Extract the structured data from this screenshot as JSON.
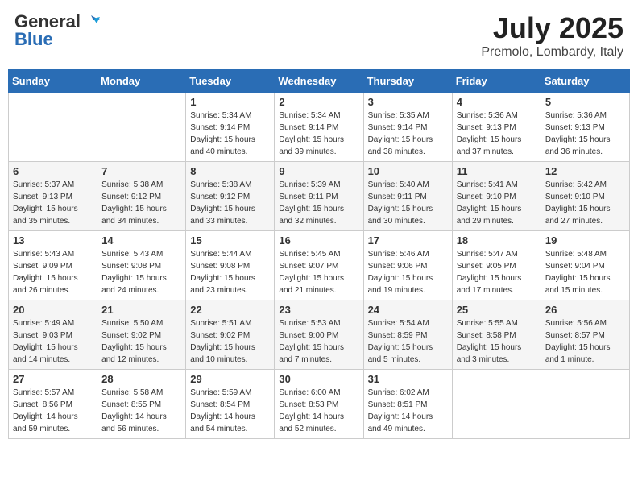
{
  "header": {
    "logo_line1": "General",
    "logo_line2": "Blue",
    "month": "July 2025",
    "location": "Premolo, Lombardy, Italy"
  },
  "weekdays": [
    "Sunday",
    "Monday",
    "Tuesday",
    "Wednesday",
    "Thursday",
    "Friday",
    "Saturday"
  ],
  "weeks": [
    [
      {
        "day": "",
        "info": ""
      },
      {
        "day": "",
        "info": ""
      },
      {
        "day": "1",
        "info": "Sunrise: 5:34 AM\nSunset: 9:14 PM\nDaylight: 15 hours\nand 40 minutes."
      },
      {
        "day": "2",
        "info": "Sunrise: 5:34 AM\nSunset: 9:14 PM\nDaylight: 15 hours\nand 39 minutes."
      },
      {
        "day": "3",
        "info": "Sunrise: 5:35 AM\nSunset: 9:14 PM\nDaylight: 15 hours\nand 38 minutes."
      },
      {
        "day": "4",
        "info": "Sunrise: 5:36 AM\nSunset: 9:13 PM\nDaylight: 15 hours\nand 37 minutes."
      },
      {
        "day": "5",
        "info": "Sunrise: 5:36 AM\nSunset: 9:13 PM\nDaylight: 15 hours\nand 36 minutes."
      }
    ],
    [
      {
        "day": "6",
        "info": "Sunrise: 5:37 AM\nSunset: 9:13 PM\nDaylight: 15 hours\nand 35 minutes."
      },
      {
        "day": "7",
        "info": "Sunrise: 5:38 AM\nSunset: 9:12 PM\nDaylight: 15 hours\nand 34 minutes."
      },
      {
        "day": "8",
        "info": "Sunrise: 5:38 AM\nSunset: 9:12 PM\nDaylight: 15 hours\nand 33 minutes."
      },
      {
        "day": "9",
        "info": "Sunrise: 5:39 AM\nSunset: 9:11 PM\nDaylight: 15 hours\nand 32 minutes."
      },
      {
        "day": "10",
        "info": "Sunrise: 5:40 AM\nSunset: 9:11 PM\nDaylight: 15 hours\nand 30 minutes."
      },
      {
        "day": "11",
        "info": "Sunrise: 5:41 AM\nSunset: 9:10 PM\nDaylight: 15 hours\nand 29 minutes."
      },
      {
        "day": "12",
        "info": "Sunrise: 5:42 AM\nSunset: 9:10 PM\nDaylight: 15 hours\nand 27 minutes."
      }
    ],
    [
      {
        "day": "13",
        "info": "Sunrise: 5:43 AM\nSunset: 9:09 PM\nDaylight: 15 hours\nand 26 minutes."
      },
      {
        "day": "14",
        "info": "Sunrise: 5:43 AM\nSunset: 9:08 PM\nDaylight: 15 hours\nand 24 minutes."
      },
      {
        "day": "15",
        "info": "Sunrise: 5:44 AM\nSunset: 9:08 PM\nDaylight: 15 hours\nand 23 minutes."
      },
      {
        "day": "16",
        "info": "Sunrise: 5:45 AM\nSunset: 9:07 PM\nDaylight: 15 hours\nand 21 minutes."
      },
      {
        "day": "17",
        "info": "Sunrise: 5:46 AM\nSunset: 9:06 PM\nDaylight: 15 hours\nand 19 minutes."
      },
      {
        "day": "18",
        "info": "Sunrise: 5:47 AM\nSunset: 9:05 PM\nDaylight: 15 hours\nand 17 minutes."
      },
      {
        "day": "19",
        "info": "Sunrise: 5:48 AM\nSunset: 9:04 PM\nDaylight: 15 hours\nand 15 minutes."
      }
    ],
    [
      {
        "day": "20",
        "info": "Sunrise: 5:49 AM\nSunset: 9:03 PM\nDaylight: 15 hours\nand 14 minutes."
      },
      {
        "day": "21",
        "info": "Sunrise: 5:50 AM\nSunset: 9:02 PM\nDaylight: 15 hours\nand 12 minutes."
      },
      {
        "day": "22",
        "info": "Sunrise: 5:51 AM\nSunset: 9:02 PM\nDaylight: 15 hours\nand 10 minutes."
      },
      {
        "day": "23",
        "info": "Sunrise: 5:53 AM\nSunset: 9:00 PM\nDaylight: 15 hours\nand 7 minutes."
      },
      {
        "day": "24",
        "info": "Sunrise: 5:54 AM\nSunset: 8:59 PM\nDaylight: 15 hours\nand 5 minutes."
      },
      {
        "day": "25",
        "info": "Sunrise: 5:55 AM\nSunset: 8:58 PM\nDaylight: 15 hours\nand 3 minutes."
      },
      {
        "day": "26",
        "info": "Sunrise: 5:56 AM\nSunset: 8:57 PM\nDaylight: 15 hours\nand 1 minute."
      }
    ],
    [
      {
        "day": "27",
        "info": "Sunrise: 5:57 AM\nSunset: 8:56 PM\nDaylight: 14 hours\nand 59 minutes."
      },
      {
        "day": "28",
        "info": "Sunrise: 5:58 AM\nSunset: 8:55 PM\nDaylight: 14 hours\nand 56 minutes."
      },
      {
        "day": "29",
        "info": "Sunrise: 5:59 AM\nSunset: 8:54 PM\nDaylight: 14 hours\nand 54 minutes."
      },
      {
        "day": "30",
        "info": "Sunrise: 6:00 AM\nSunset: 8:53 PM\nDaylight: 14 hours\nand 52 minutes."
      },
      {
        "day": "31",
        "info": "Sunrise: 6:02 AM\nSunset: 8:51 PM\nDaylight: 14 hours\nand 49 minutes."
      },
      {
        "day": "",
        "info": ""
      },
      {
        "day": "",
        "info": ""
      }
    ]
  ]
}
